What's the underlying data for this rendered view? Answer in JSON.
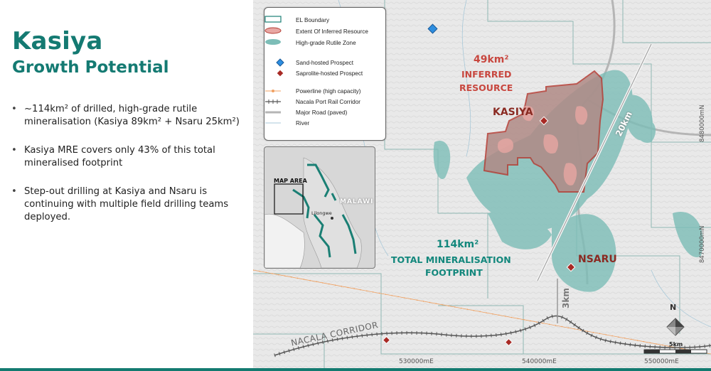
{
  "slide": {
    "title": "Kasiya",
    "subtitle": "Growth Potential",
    "bullets": [
      "~114km² of drilled, high-grade rutile mineralisation (Kasiya 89km² + Nsaru 25km²)",
      "Kasiya MRE covers only 43% of this total mineralised footprint",
      "Step-out drilling at Kasiya and Nsaru is continuing with multiple field drilling teams deployed."
    ],
    "accent_color": "#147a72"
  },
  "legend": {
    "items": [
      {
        "icon": "el-boundary-swatch",
        "label": "EL Boundary"
      },
      {
        "icon": "inferred-resource-swatch",
        "label": "Extent Of Inferred Resource"
      },
      {
        "icon": "rutile-zone-swatch",
        "label": "High-grade Rutile Zone"
      },
      {
        "icon": "blue-diamond-icon",
        "label": "Sand-hosted Prospect"
      },
      {
        "icon": "red-diamond-icon",
        "label": "Saprolite-hosted Prospect"
      },
      {
        "icon": "powerline-swatch",
        "label": "Powerline (high capacity)"
      },
      {
        "icon": "rail-swatch",
        "label": "Nacala Port Rail Corridor"
      },
      {
        "icon": "road-swatch",
        "label": "Major Road (paved)"
      },
      {
        "icon": "river-swatch",
        "label": "River"
      }
    ]
  },
  "inset": {
    "map_area_label": "MAP AREA",
    "country_label": "MALAWI",
    "city_label": "Lilongwe"
  },
  "map": {
    "inferred_area": "49km²",
    "inferred_line1": "INFERRED",
    "inferred_line2": "RESOURCE",
    "kasiya_label": "KASIYA",
    "nsaru_label": "NSARU",
    "total_area": "114km²",
    "total_line1": "TOTAL MINERALISATION",
    "total_line2": "FOOTPRINT",
    "distance_20km": "20km",
    "distance_3km": "3km",
    "corridor_label": "NACALA CORRIDOR",
    "coord_x1": "530000mE",
    "coord_x2": "540000mE",
    "coord_x3": "550000mE",
    "coord_y1": "8480000mN",
    "coord_y2": "8470000mN",
    "north_label": "N",
    "scale_label": "5km",
    "colors": {
      "resource_red": "#c8473f",
      "rutile_teal": "#7cbdb7",
      "boundary_teal": "#1a7f74"
    }
  }
}
